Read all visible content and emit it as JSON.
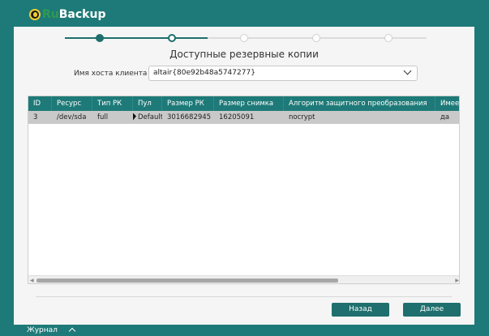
{
  "app": {
    "logo_ru": "Ru",
    "logo_backup": "Backup"
  },
  "colors": {
    "accent": "#1e7a78",
    "button": "#1e6f6d",
    "selected_row": "#c9c9c9",
    "logo_yellow": "#f4cf30",
    "logo_green": "#2f9a53"
  },
  "wizard": {
    "total_steps": 6,
    "completed_steps": 2,
    "current_step": 2
  },
  "dialog": {
    "title": "Доступные резервные копии",
    "host_label": "Имя хоста клиента",
    "host_value": "altair{80e92b48a5747277}"
  },
  "table": {
    "columns": [
      "ID",
      "Ресурс",
      "Тип РК",
      "Пул",
      "Размер РК",
      "Размер снимка",
      "Алгоритм защитного преобразования",
      "Имеет"
    ],
    "rows": [
      [
        "3",
        "/dev/sda",
        "full",
        "Default",
        "3016682945",
        "16205091",
        "nocrypt",
        "да"
      ]
    ]
  },
  "buttons": {
    "back": "Назад",
    "next": "Далее"
  },
  "footer": {
    "journal": "Журнал"
  }
}
